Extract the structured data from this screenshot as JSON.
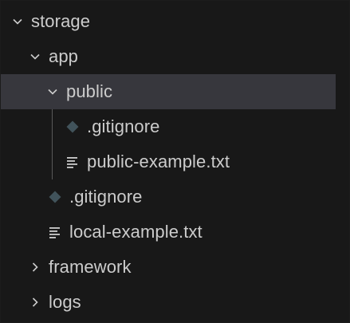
{
  "explorer": {
    "items": [
      {
        "label": "storage",
        "type": "folder",
        "state": "expanded",
        "depth": 0
      },
      {
        "label": "app",
        "type": "folder",
        "state": "expanded",
        "depth": 1
      },
      {
        "label": "public",
        "type": "folder",
        "state": "expanded",
        "depth": 2,
        "selected": true
      },
      {
        "label": ".gitignore",
        "type": "file",
        "icon": "gitignore-icon",
        "depth": 3
      },
      {
        "label": "public-example.txt",
        "type": "file",
        "icon": "text-file-icon",
        "depth": 3
      },
      {
        "label": ".gitignore",
        "type": "file",
        "icon": "gitignore-icon",
        "depth": 2
      },
      {
        "label": "local-example.txt",
        "type": "file",
        "icon": "text-file-icon",
        "depth": 2
      },
      {
        "label": "framework",
        "type": "folder",
        "state": "collapsed",
        "depth": 1
      },
      {
        "label": "logs",
        "type": "folder",
        "state": "collapsed",
        "depth": 1
      }
    ]
  },
  "colors": {
    "background": "#181818",
    "selected_row": "#37373d",
    "text": "#cccccc",
    "gitignore_icon": "#41535b"
  }
}
